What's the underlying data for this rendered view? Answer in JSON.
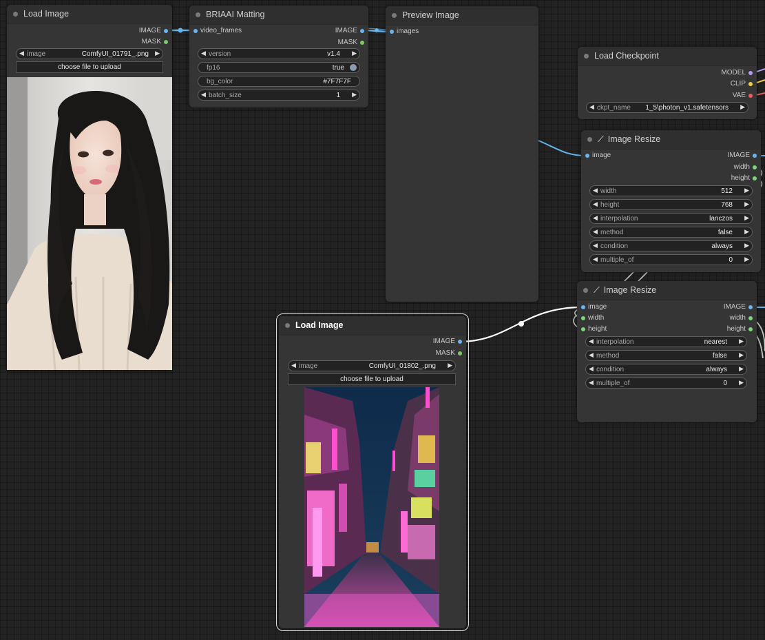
{
  "colors": {
    "image_slot": "#6bb4f0",
    "mask_slot": "#80c868",
    "int_slot": "#7ed67a",
    "model_slot": "#b79cf0",
    "clip_slot": "#f0d040",
    "vae_slot": "#f05a5a",
    "link_image": "#64b4ec"
  },
  "nodes": {
    "load_image_1": {
      "title": "Load Image",
      "outputs": [
        "IMAGE",
        "MASK"
      ],
      "widget_image_label": "image",
      "widget_image_value": "ComfyUI_01791_.png",
      "upload_label": "choose file to upload",
      "preview_desc": "portrait"
    },
    "briaai": {
      "title": "BRIAAI Matting",
      "input": "video_frames",
      "outputs": [
        "IMAGE",
        "MASK"
      ],
      "widgets": [
        {
          "label": "version",
          "value": "v1.4"
        },
        {
          "label": "fp16",
          "value": "true"
        },
        {
          "label": "bg_color",
          "value": "#7F7F7F"
        },
        {
          "label": "batch_size",
          "value": "1"
        }
      ]
    },
    "preview_image": {
      "title": "Preview Image",
      "input": "images"
    },
    "load_checkpoint": {
      "title": "Load Checkpoint",
      "outputs": [
        "MODEL",
        "CLIP",
        "VAE"
      ],
      "widget_label": "ckpt_name",
      "widget_value": "1_5\\photon_v1.safetensors"
    },
    "image_resize_1": {
      "title": "Image Resize",
      "input": "image",
      "outputs": [
        "IMAGE",
        "width",
        "height"
      ],
      "widgets": [
        {
          "label": "width",
          "value": "512"
        },
        {
          "label": "height",
          "value": "768"
        },
        {
          "label": "interpolation",
          "value": "lanczos"
        },
        {
          "label": "method",
          "value": "false"
        },
        {
          "label": "condition",
          "value": "always"
        },
        {
          "label": "multiple_of",
          "value": "0"
        }
      ]
    },
    "image_resize_2": {
      "title": "Image Resize",
      "inputs": [
        "image",
        "width",
        "height"
      ],
      "outputs": [
        "IMAGE",
        "width",
        "height"
      ],
      "widgets": [
        {
          "label": "interpolation",
          "value": "nearest"
        },
        {
          "label": "method",
          "value": "false"
        },
        {
          "label": "condition",
          "value": "always"
        },
        {
          "label": "multiple_of",
          "value": "0"
        }
      ]
    },
    "load_image_2": {
      "title": "Load Image",
      "outputs": [
        "IMAGE",
        "MASK"
      ],
      "widget_image_label": "image",
      "widget_image_value": "ComfyUI_01802_.png",
      "upload_label": "choose file to upload"
    }
  }
}
